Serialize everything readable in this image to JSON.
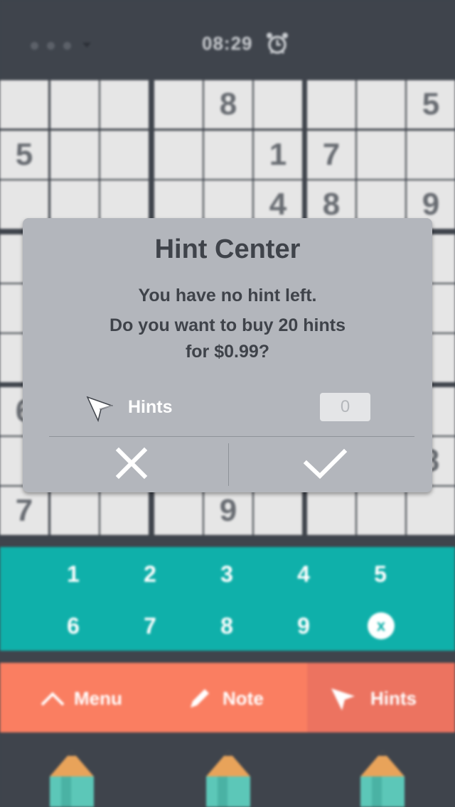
{
  "status_bar": {
    "timer": "08:29",
    "alarm_icon": "alarm-clock-icon"
  },
  "sudoku": {
    "visible_values": [
      {
        "row": 0,
        "col": 4,
        "value": "8"
      },
      {
        "row": 0,
        "col": 8,
        "value": "5"
      },
      {
        "row": 1,
        "col": 0,
        "value": "5"
      },
      {
        "row": 1,
        "col": 5,
        "value": "1"
      },
      {
        "row": 1,
        "col": 6,
        "value": "7"
      },
      {
        "row": 2,
        "col": 5,
        "value": "4"
      },
      {
        "row": 2,
        "col": 6,
        "value": "8"
      },
      {
        "row": 2,
        "col": 8,
        "value": "9"
      },
      {
        "row": 6,
        "col": 0,
        "value": "6"
      },
      {
        "row": 7,
        "col": 8,
        "value": "8"
      },
      {
        "row": 8,
        "col": 0,
        "value": "7"
      },
      {
        "row": 8,
        "col": 4,
        "value": "9"
      }
    ]
  },
  "keypad": {
    "keys": [
      "1",
      "2",
      "3",
      "4",
      "5",
      "6",
      "7",
      "8",
      "9"
    ],
    "erase_glyph": "x"
  },
  "toolbar": {
    "menu_label": "Menu",
    "note_label": "Note",
    "hints_label": "Hints"
  },
  "dialog": {
    "title": "Hint Center",
    "line1": "You have no hint left.",
    "line2": "Do you want to buy 20 hints",
    "line3": "for $0.99?",
    "hints_label": "Hints",
    "hints_count": "0"
  },
  "colors": {
    "background": "#3f444c",
    "cell": "#e6e6e6",
    "keypad": "#0fb0aa",
    "toolbar": "#fa7e61",
    "dialog": "#b3b6bc"
  }
}
